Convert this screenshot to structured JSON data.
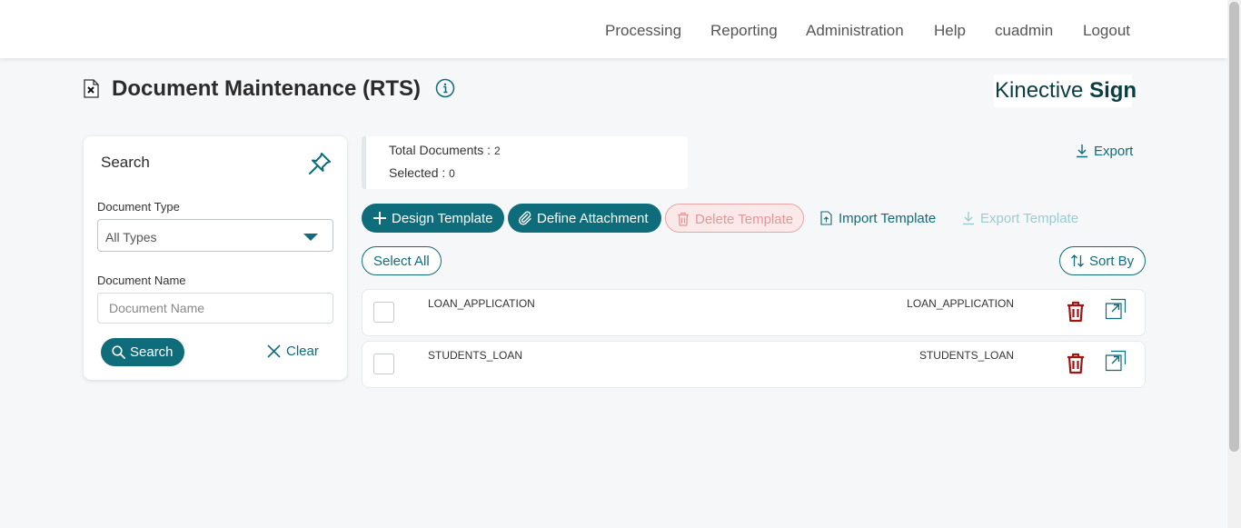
{
  "nav": {
    "items": [
      "Processing",
      "Reporting",
      "Administration",
      "Help",
      "cuadmin",
      "Logout"
    ]
  },
  "page": {
    "title": "Document Maintenance (RTS)",
    "title_icon": "document-x-icon",
    "info_icon": "info-icon"
  },
  "brand": {
    "text_regular": "Kinective ",
    "text_bold": "Sign"
  },
  "search": {
    "title": "Search",
    "pin_icon": "pin-icon",
    "doc_type_label": "Document Type",
    "doc_type_value": "All Types",
    "doc_name_label": "Document Name",
    "doc_name_placeholder": "Document Name",
    "search_button": "Search",
    "clear_button": "Clear"
  },
  "summary": {
    "total_label": "Total Documents : ",
    "total_value": "2",
    "selected_label": "Selected : ",
    "selected_value": "0"
  },
  "actions": {
    "export": "Export",
    "design_template": "Design Template",
    "define_attachment": "Define Attachment",
    "delete_template": "Delete Template",
    "import_template": "Import Template",
    "export_template": "Export Template",
    "select_all": "Select All",
    "sort_by": "Sort By"
  },
  "documents": [
    {
      "name": "LOAN_APPLICATION",
      "description": "LOAN_APPLICATION"
    },
    {
      "name": "STUDENTS_LOAN",
      "description": "STUDENTS_LOAN"
    }
  ],
  "colors": {
    "accent": "#0f6c7a",
    "delete_red": "#a01414",
    "disabled_red": "#e09898",
    "background": "#f5f7f8"
  }
}
